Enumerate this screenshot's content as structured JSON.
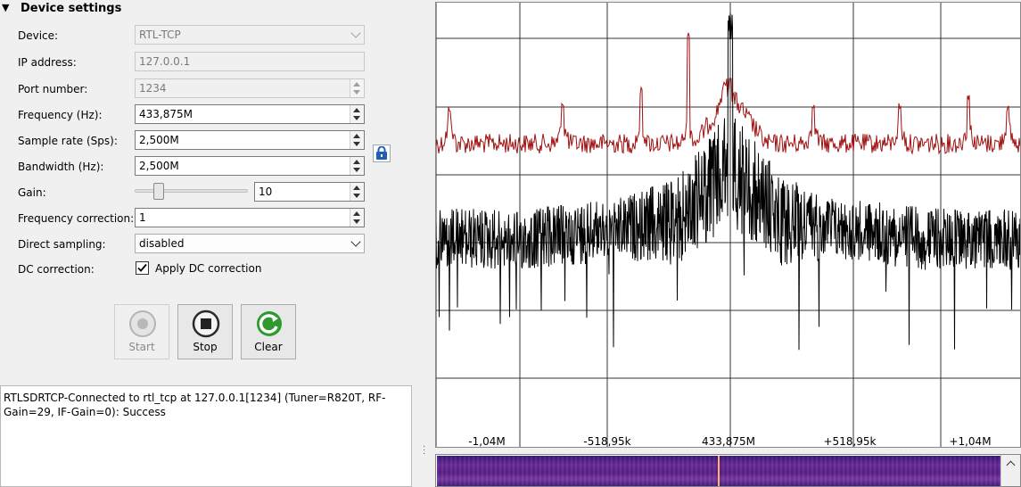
{
  "section": {
    "title": "Device settings"
  },
  "form": {
    "device_label": "Device:",
    "device_value": "RTL-TCP",
    "ip_label": "IP address:",
    "ip_value": "127.0.0.1",
    "port_label": "Port number:",
    "port_value": "1234",
    "freq_label": "Frequency (Hz):",
    "freq_value": "433,875M",
    "rate_label": "Sample rate (Sps):",
    "rate_value": "2,500M",
    "bw_label": "Bandwidth (Hz):",
    "bw_value": "2,500M",
    "gain_label": "Gain:",
    "gain_value": "10",
    "fcorr_label": "Frequency correction:",
    "fcorr_value": "1",
    "ds_label": "Direct sampling:",
    "ds_value": "disabled",
    "dc_label": "DC correction:",
    "dc_check_label": "Apply DC correction"
  },
  "buttons": {
    "start": "Start",
    "stop": "Stop",
    "clear": "Clear"
  },
  "log": {
    "text": "RTLSDRTCP-Connected to rtl_tcp at 127.0.0.1[1234] (Tuner=R820T, RF-Gain=29, IF-Gain=0): Success"
  },
  "spectrum": {
    "ticks": [
      "-1,04M",
      "-518,95k",
      "433,875M",
      "+518,95k",
      "+1,04M"
    ]
  },
  "colors": {
    "max_hold": "#a01010",
    "trace": "#000000",
    "waterfall_marker": "#ffb36b"
  }
}
